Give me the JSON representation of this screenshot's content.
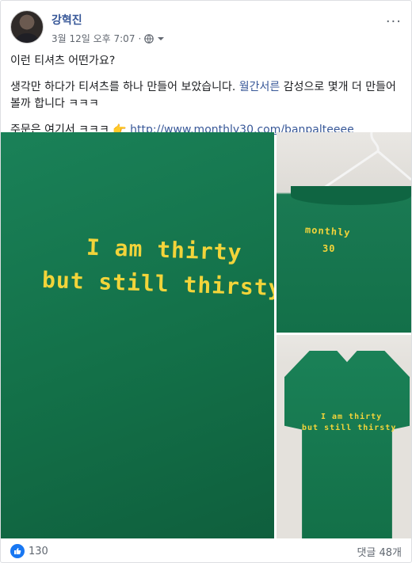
{
  "post": {
    "author": "강혁진",
    "timestamp": "3월 12일 오후 7:07",
    "separator": "·",
    "more": "···",
    "line1": "이런 티셔츠 어떤가요?",
    "line2_before": "생각만 하다가 티셔츠를 하나 만들어 보았습니다. ",
    "line2_tag": "월간서른",
    "line2_after": " 감성으로 몇개 더 만들어볼까 합니다 ㅋㅋㅋ",
    "line3_before": "주문은 여기서 ㅋㅋㅋ 👉 ",
    "link": "http://www.monthly30.com/banpalteeee"
  },
  "photos": {
    "main_line1": "I am thirty",
    "main_line2": "but still thirsty",
    "top_line1": "monthly",
    "top_line2": "30",
    "bot_line1": "I am thirty",
    "bot_line2": "but still thirsty"
  },
  "footer": {
    "likes": "130",
    "comments": "댓글 48개"
  },
  "colors": {
    "link": "#385898",
    "shirt": "#137048",
    "print": "#f2d43a",
    "like": "#1877f2"
  }
}
